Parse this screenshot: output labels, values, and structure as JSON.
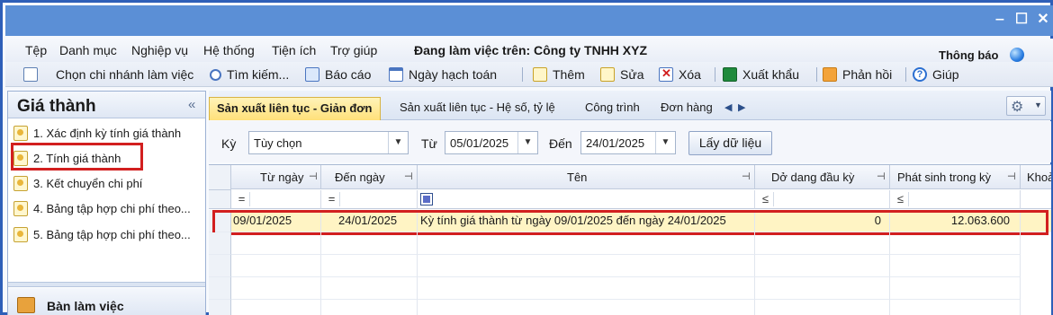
{
  "window": {
    "min_glyph": "‒",
    "max_glyph": "☐",
    "close_glyph": "✕"
  },
  "menu": {
    "items": [
      "Tệp",
      "Danh mục",
      "Nghiệp vụ",
      "Hệ thống",
      "Tiện ích",
      "Trợ giúp"
    ],
    "working_on": "Đang làm việc trên: Công ty TNHH XYZ",
    "notice": "Thông báo"
  },
  "toolbar": {
    "branch": "Chọn chi nhánh làm việc",
    "search": "Tìm kiếm...",
    "report": "Báo cáo",
    "posting_date": "Ngày hạch toán",
    "add": "Thêm",
    "edit": "Sửa",
    "delete": "Xóa",
    "export": "Xuất khẩu",
    "feedback": "Phản hồi",
    "help": "Giúp",
    "help_glyph": "?"
  },
  "left_panel": {
    "title": "Giá thành",
    "collapse_glyph": "«",
    "items": [
      "1. Xác định kỳ tính giá thành",
      "2. Tính giá thành",
      "3. Kết chuyển chi phí",
      "4. Bảng tập hợp chi phí theo...",
      "5. Bảng tập hợp chi phí theo..."
    ],
    "footer": "Bàn làm việc"
  },
  "tabs": {
    "items": [
      "Sản xuất liên tục - Giản đơn",
      "Sản xuất liên tục - Hệ số, tỷ lệ",
      "Công trình",
      "Đơn hàng"
    ],
    "prev_glyph": "◀",
    "next_glyph": "▶",
    "gear_glyph": "⚙",
    "caret_glyph": "▼"
  },
  "filter": {
    "period_label": "Kỳ",
    "period_value": "Tùy chọn",
    "from_label": "Từ",
    "from_value": "05/01/2025",
    "to_label": "Đến",
    "to_value": "24/01/2025",
    "load_button": "Lấy dữ liệu",
    "caret_glyph": "▼"
  },
  "grid": {
    "columns": [
      "Từ ngày",
      "Đến ngày",
      "Tên",
      "Dở dang đầu kỳ",
      "Phát sinh trong kỳ",
      "Khoả"
    ],
    "pin_glyph": "⊣",
    "filter_ops": [
      "=",
      "=",
      "",
      "≤",
      "≤"
    ],
    "rows": [
      {
        "from": "09/01/2025",
        "to": "24/01/2025",
        "name": "Kỳ tính giá thành từ ngày 09/01/2025 đến ngày 24/01/2025",
        "opening": "0",
        "incurred": "12.063.600"
      }
    ]
  }
}
